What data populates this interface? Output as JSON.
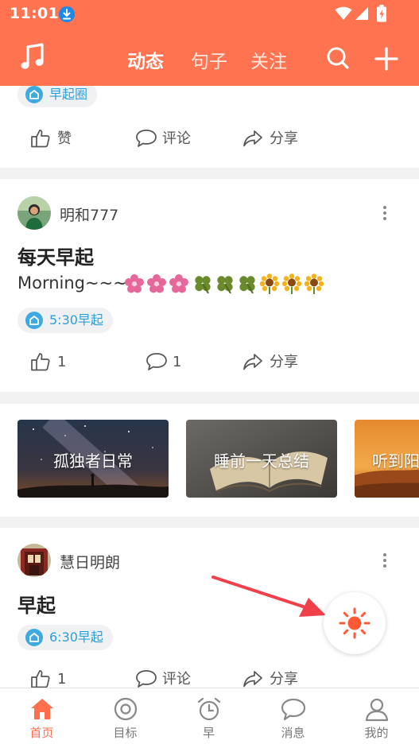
{
  "status_bar": {
    "time": "11:01"
  },
  "app_bar": {
    "tabs": [
      {
        "label": "动态",
        "active": true
      },
      {
        "label": "句子",
        "active": false
      },
      {
        "label": "关注",
        "active": false
      }
    ]
  },
  "feed": {
    "partial_card": {
      "tag": "早起圈",
      "actions": {
        "like": "赞",
        "comment": "评论",
        "share": "分享"
      }
    },
    "posts": [
      {
        "author": "明和777",
        "title": "每天早起",
        "body": "Morning~~~",
        "emoji": [
          "pink-blossom",
          "pink-blossom",
          "pink-blossom",
          "four-leaf-clover",
          "four-leaf-clover",
          "four-leaf-clover",
          "sunflower",
          "sunflower",
          "sunflower"
        ],
        "tag": "5:30早起",
        "likes": "1",
        "comments": "1",
        "share": "分享"
      },
      {
        "author": "慧日明朗",
        "title": "早起",
        "tag": "6:30早起",
        "likes": "1",
        "comment": "评论",
        "share": "分享"
      }
    ],
    "topics": [
      {
        "label": "孤独者日常",
        "image": "starry-night-silhouette"
      },
      {
        "label": "睡前一天总结",
        "image": "open-book"
      },
      {
        "label": "听到阳",
        "image": "orange-sunset-hills"
      }
    ]
  },
  "fab": {
    "icon": "sun-icon",
    "color": "#ff5a36"
  },
  "bottom_nav": [
    {
      "label": "首页",
      "icon": "home-icon",
      "active": true
    },
    {
      "label": "目标",
      "icon": "target-icon",
      "active": false
    },
    {
      "label": "早",
      "icon": "alarm-clock-icon",
      "active": false
    },
    {
      "label": "消息",
      "icon": "message-icon",
      "active": false
    },
    {
      "label": "我的",
      "icon": "profile-icon",
      "active": false
    }
  ],
  "colors": {
    "brand": "#ff7350",
    "accent": "#ff6f4d",
    "tag_text": "#2aa0d8",
    "annotation_arrow": "#f0414a"
  }
}
